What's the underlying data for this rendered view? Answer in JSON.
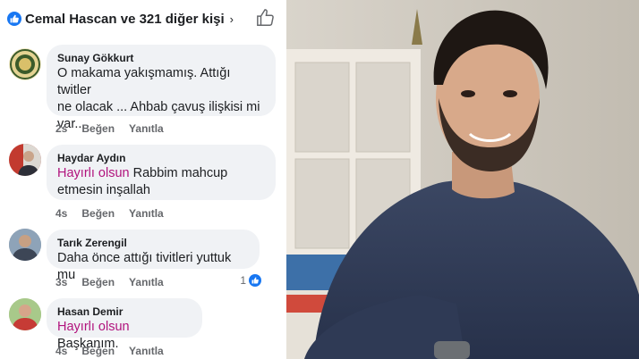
{
  "header": {
    "reactions_text": "Cemal Hascan ve 321 diğer kişi",
    "chevron": "›",
    "like_icon": "thumbs-up-icon"
  },
  "comments": [
    {
      "author": "Sunay Gökkurt",
      "text_lines": [
        "O makama yakışmamış. Attığı twitler",
        "ne olacak ... Ahbab çavuş ilişkisi mi",
        "var..."
      ],
      "time": "2s",
      "like": "Beğen",
      "reply": "Yanıtla"
    },
    {
      "author": "Haydar Aydın",
      "highlight": "Hayırlı olsun",
      "text_rest": " Rabbim mahcup",
      "text_line2": "etmesin inşallah",
      "time": "4s",
      "like": "Beğen",
      "reply": "Yanıtla"
    },
    {
      "author": "Tarık Zerengil",
      "text": "Daha önce attığı tivitleri yuttuk mu",
      "time": "3s",
      "like": "Beğen",
      "reply": "Yanıtla",
      "reaction_count": "1"
    },
    {
      "author": "Hasan Demir",
      "highlight": "Hayırlı olsun",
      "text_rest": " Başkanım.",
      "time": "4s",
      "like": "Beğen",
      "reply": "Yanıtla"
    }
  ],
  "colors": {
    "facebook_blue": "#1877f2",
    "bubble": "#f0f2f5",
    "highlight": "#b1137d",
    "meta_text": "#65676b"
  }
}
